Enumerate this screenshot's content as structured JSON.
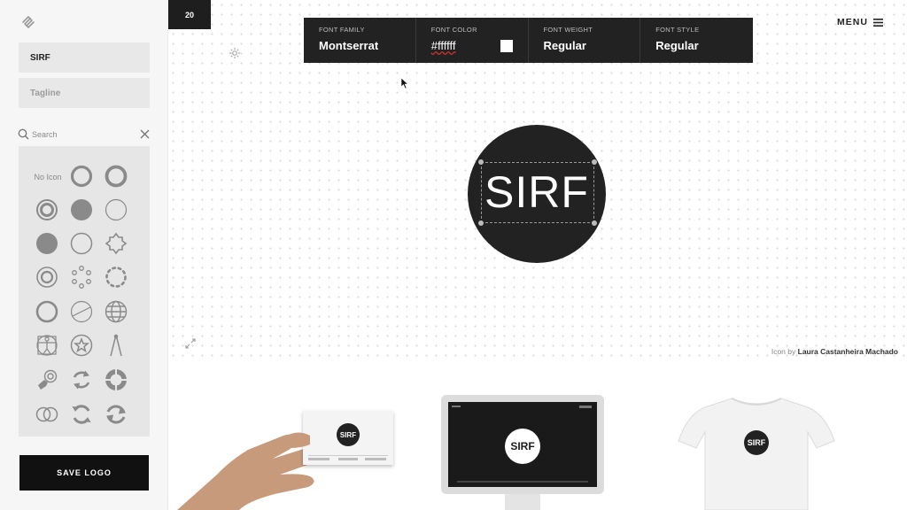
{
  "sidebar": {
    "logo_icon": "squarespace-logo-icon",
    "name_value": "SIRF",
    "tagline_placeholder": "Tagline",
    "search_placeholder": "Search",
    "no_icon_label": "No Icon",
    "save_label": "SAVE LOGO"
  },
  "canvas": {
    "size_value": "20",
    "menu_label": "MENU",
    "logo_text": "SIRF",
    "credit_prefix": "Icon by",
    "credit_author": "Laura Castanheira Machado"
  },
  "font_toolbar": [
    {
      "label": "FONT FAMILY",
      "value": "Montserrat"
    },
    {
      "label": "FONT COLOR",
      "value": "#ffffff"
    },
    {
      "label": "FONT WEIGHT",
      "value": "Regular"
    },
    {
      "label": "FONT STYLE",
      "value": "Regular"
    }
  ],
  "colors": {
    "logo_background": "#222222",
    "font_color": "#ffffff",
    "save_button": "#111111"
  },
  "mockups": {
    "card_text": "SIRF",
    "monitor_text": "SIRF",
    "tshirt_text": "SIRF"
  }
}
